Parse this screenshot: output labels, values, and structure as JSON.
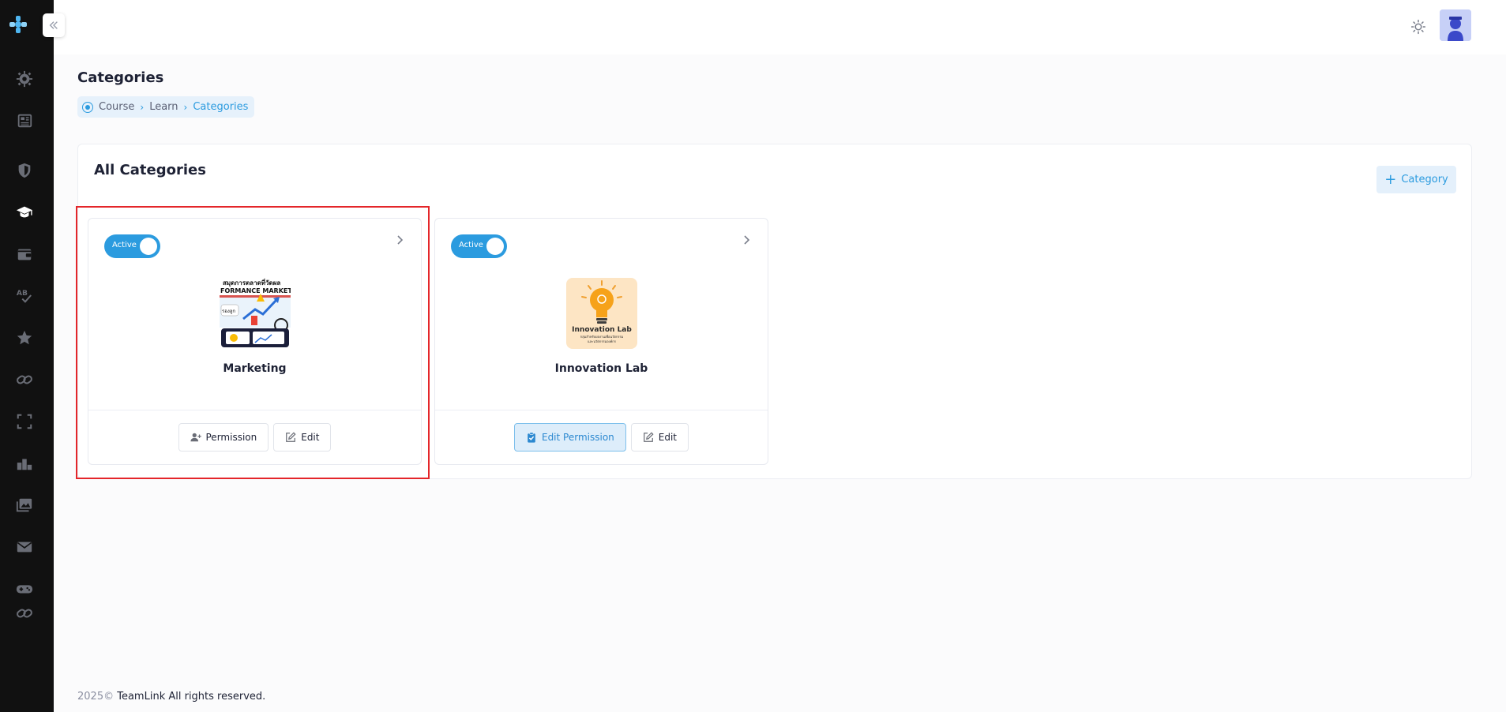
{
  "header": {
    "theme_icon": "sun-icon",
    "avatar_icon": "user-avatar"
  },
  "sidebar": {
    "items": [
      {
        "icon": "gear-icon"
      },
      {
        "icon": "newspaper-icon"
      },
      {
        "icon": "shield-icon"
      },
      {
        "icon": "graduation-cap-icon"
      },
      {
        "icon": "wallet-icon"
      },
      {
        "icon": "spellcheck-icon"
      },
      {
        "icon": "star-icon"
      },
      {
        "icon": "link-icon"
      },
      {
        "icon": "expand-icon"
      },
      {
        "icon": "podium-icon"
      },
      {
        "icon": "images-icon"
      },
      {
        "icon": "envelope-icon"
      },
      {
        "icon": "gamepad-icon"
      },
      {
        "icon": "link-icon"
      }
    ]
  },
  "page": {
    "title": "Categories",
    "breadcrumb": {
      "course": "Course",
      "learn": "Learn",
      "current": "Categories"
    }
  },
  "panel": {
    "title": "All Categories",
    "add_button": "Category"
  },
  "categories": [
    {
      "name": "Marketing",
      "status": "Active",
      "thumb_lines": [
        "สมุดการตลาดที่วัดผล",
        "FORMANCE MARKET",
        "รองลูก"
      ],
      "buttons": {
        "permission": "Permission",
        "edit": "Edit"
      }
    },
    {
      "name": "Innovation Lab",
      "status": "Active",
      "thumb_lines": [
        "Innovation Lab",
        "กลุ่มสำหรับผลงานเพื่อนวัตกรรม",
        "และนวัตกรรมองค์กร"
      ],
      "buttons": {
        "permission": "Edit Permission",
        "edit": "Edit"
      }
    }
  ],
  "footer": {
    "year": "2025©",
    "text": "TeamLink All rights reserved."
  },
  "colors": {
    "accent": "#2b9bdf",
    "sidebar_bg": "#111111",
    "highlight": "#e4262a"
  }
}
